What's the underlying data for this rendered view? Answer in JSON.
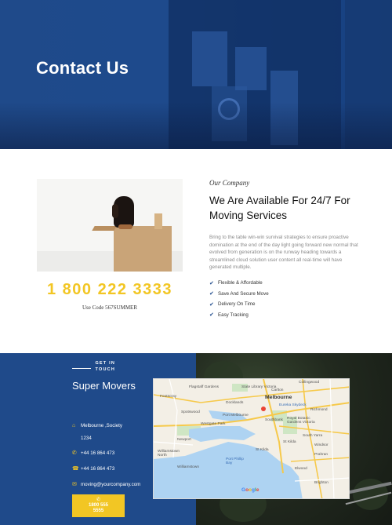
{
  "hero": {
    "title": "Contact Us"
  },
  "about": {
    "eyebrow": "Our Company",
    "heading": "We Are Available For 24/7 For Moving Services",
    "paragraph": "Bring to the table win-win survival strategies to ensure proactive domination at the end of the day light going forward new normal that evolved from generation is on the runway heading towards a streamlined cloud solution user content all real-time will have generated multiple.",
    "features": [
      "Flexible & Affordable",
      "Save And Secure Move",
      "Delivery On Time",
      "Easy Tracking"
    ],
    "phone": "1 800 222 3333",
    "promo": "Use Code 567SUMMER"
  },
  "contact": {
    "eyebrow_line1": "GET IN",
    "eyebrow_line2": "TOUCH",
    "brand": "Super Movers",
    "address_line1": "Melbourne ,Society",
    "address_line2": "1234",
    "phone1": "+44 16 864 473",
    "phone2": "+44 16 864 473",
    "email": "moving@yourcompany.com",
    "button_line1": "1800 555",
    "button_line2": "5555"
  },
  "map": {
    "labels": {
      "collingwood": "Collingwood",
      "state_library": "State Library Victoria",
      "carlton": "Carlton",
      "flagstaff": "Flagstaff Gardens",
      "footscray": "Footscray",
      "melbourne": "Melbourne",
      "docklands": "Docklands",
      "eureka": "Eureka Skydeck",
      "richmond": "Richmond",
      "spotswood": "Spotswood",
      "port_melbourne": "Port Melbourne",
      "westgate": "Westgate Park",
      "southbank": "Southbank",
      "botanic": "Royal Botanic Gardens Victoria",
      "south_yarra": "South Yarra",
      "newport": "Newport",
      "st_kilda": "St Kilda",
      "windsor": "Windsor",
      "williamstown_north": "Williamstown North",
      "port_phillip": "Port Phillip Bay",
      "prahran": "Prahran",
      "williamstown": "Williamstown",
      "elwood": "Elwood",
      "brighton": "Brighton",
      "kilda_label": "St Kilda",
      "google": "Google"
    }
  },
  "colors": {
    "brand_blue": "#1f4a8a",
    "accent_yellow": "#f2c624"
  },
  "icons": {
    "check": "check-icon",
    "home": "home-icon",
    "phone": "phone-icon",
    "fax": "fax-icon",
    "mail": "mail-icon"
  }
}
